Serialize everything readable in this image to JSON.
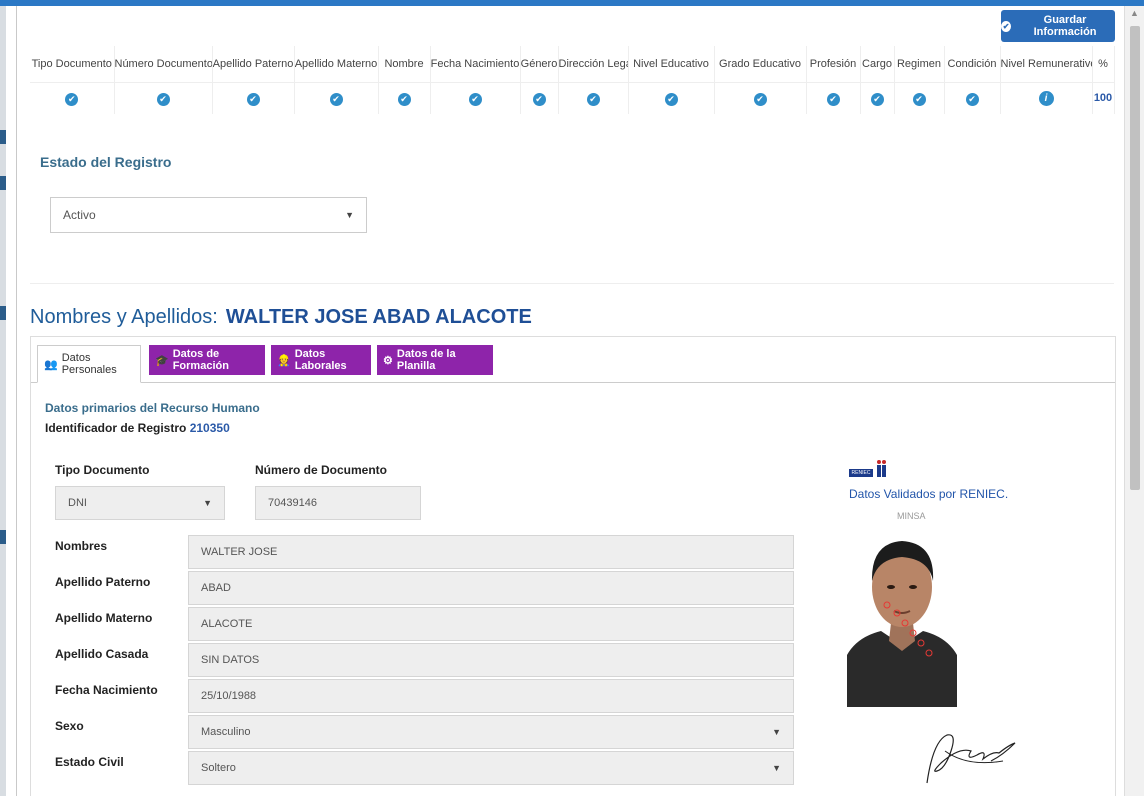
{
  "header": {
    "save_label": "Guardar Información",
    "save_icon": "check-circle-icon"
  },
  "status_table": {
    "columns": [
      "Tipo Documento",
      "Número Documento",
      "Apellido Paterno",
      "Apellido Materno",
      "Nombre",
      "Fecha Nacimiento",
      "Género",
      "Dirección Legal",
      "Nivel Educativo",
      "Grado Educativo",
      "Profesión",
      "Cargo",
      "Regimen",
      "Condición",
      "Nivel Remunerativo",
      "%"
    ],
    "statuses": [
      "check",
      "check",
      "check",
      "check",
      "check",
      "check",
      "check",
      "check",
      "check",
      "check",
      "check",
      "check",
      "check",
      "check",
      "info"
    ],
    "percent": "100"
  },
  "estado": {
    "title": "Estado del Registro",
    "selected": "Activo"
  },
  "person": {
    "label": "Nombres y Apellidos:",
    "name": "WALTER JOSE ABAD ALACOTE"
  },
  "tabs": [
    {
      "label": "Datos Personales",
      "icon": "users-icon",
      "active": true
    },
    {
      "label": "Datos de Formación",
      "icon": "graduation-icon",
      "active": false
    },
    {
      "label": "Datos Laborales",
      "icon": "worker-icon",
      "active": false
    },
    {
      "label": "Datos de la Planilla",
      "icon": "gear-icon",
      "active": false
    }
  ],
  "form": {
    "section_title": "Datos primarios del Recurso Humano",
    "registro_label": "Identificador de Registro",
    "registro_id": "210350",
    "tipo_documento_label": "Tipo Documento",
    "tipo_documento_value": "DNI",
    "numero_documento_label": "Número de Documento",
    "numero_documento_value": "70439146",
    "fields": [
      {
        "label": "Nombres",
        "value": "WALTER JOSE"
      },
      {
        "label": "Apellido Paterno",
        "value": "ABAD"
      },
      {
        "label": "Apellido Materno",
        "value": "ALACOTE"
      },
      {
        "label": "Apellido Casada",
        "value": "SIN DATOS"
      },
      {
        "label": "Fecha Nacimiento",
        "value": "25/10/1988"
      },
      {
        "label": "Sexo",
        "value": "Masculino"
      },
      {
        "label": "Estado Civil",
        "value": "Soltero"
      }
    ]
  },
  "reniec": {
    "logo_text": "RENIEC",
    "validated_text": "Datos Validados por RENIEC.",
    "photo_watermark": "MINSA"
  },
  "colors": {
    "primary": "#2b6cb8",
    "purple": "#8e24aa",
    "heading": "#1f4f96",
    "check": "#2f8ec9"
  }
}
